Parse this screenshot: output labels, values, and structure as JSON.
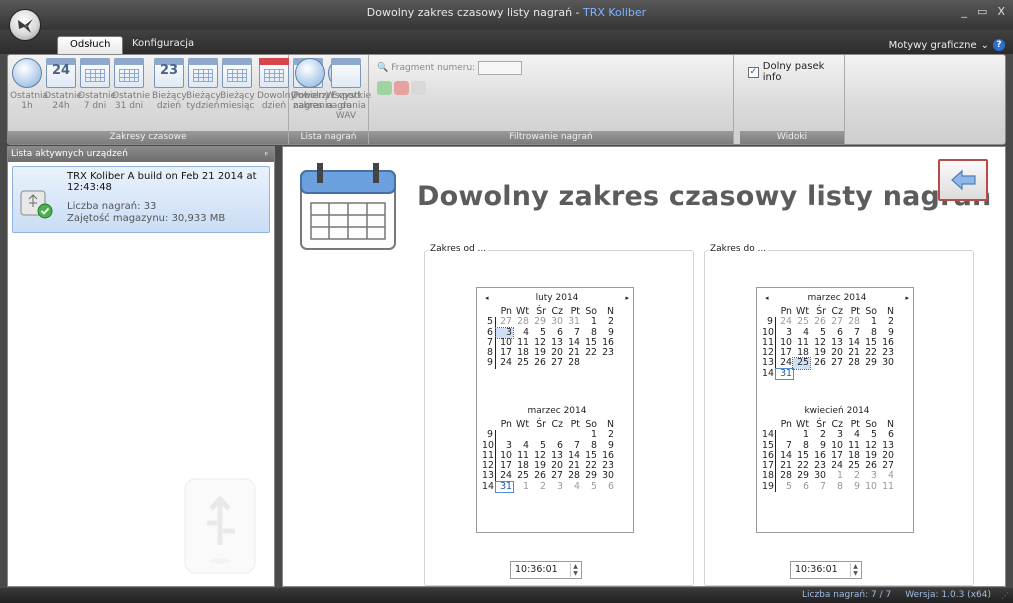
{
  "window": {
    "title_main": "Dowolny zakres czasowy listy nagrań - ",
    "title_app": "TRX Koliber",
    "controls": [
      "_",
      "▭",
      "X"
    ]
  },
  "tabs": [
    {
      "label": "Odsłuch",
      "active": true
    },
    {
      "label": "Konfiguracja",
      "active": false
    }
  ],
  "themes": {
    "label": "Motywy graficzne",
    "chevron": "⌄",
    "help": "?"
  },
  "ribbon": {
    "groups": [
      {
        "label": "Zakresy czasowe",
        "buttons": [
          {
            "icon": "clock-icon",
            "line1": "Ostatnia",
            "line2": "1h"
          },
          {
            "icon": "calendar-24-icon",
            "number": "24",
            "line1": "Ostatnie",
            "line2": "24h"
          },
          {
            "icon": "calendar-week-icon",
            "line1": "Ostatnie",
            "line2": "7 dni"
          },
          {
            "icon": "calendar-month-icon",
            "line1": "Ostatnie",
            "line2": "31 dni"
          },
          {
            "icon": "calendar-day-icon",
            "number": "23",
            "line1": "Bieżący",
            "line2": "dzień"
          },
          {
            "icon": "calendar-week-icon",
            "line1": "Bieżący",
            "line2": "tydzień"
          },
          {
            "icon": "calendar-month-icon",
            "line1": "Bieżący",
            "line2": "miesiąc"
          },
          {
            "icon": "calendar-question-icon",
            "line1": "Dowolny",
            "line2": "dzień"
          },
          {
            "icon": "calendar-range-icon",
            "line1": "Dowolny",
            "line2": "zakres"
          },
          {
            "icon": "globe-icon",
            "line1": "Wszystkie",
            "line2": "nagrania"
          }
        ]
      },
      {
        "label": "Lista nagrań",
        "buttons": [
          {
            "icon": "refresh-icon",
            "line1": "Pobierz",
            "line2": "nagrania"
          },
          {
            "icon": "wav-export-icon",
            "line1": "Export",
            "line2": "do WAV"
          }
        ]
      },
      {
        "label": "Filtrowanie nagrań",
        "fragment_label": "Fragment numeru:"
      },
      {
        "label": "Widoki",
        "checkbox_label": "Dolny pasek info",
        "checked": true
      }
    ]
  },
  "sidebar": {
    "title": "Lista aktywnych urządzeń",
    "pin": "ᵖ",
    "device": {
      "name": "TRX Koliber A build on Feb 21 2014 at 12:43:48",
      "recordings": "Liczba nagrań: 33",
      "storage": "Zajętość magazynu: 30,933 MB"
    }
  },
  "main": {
    "title": "Dowolny zakres czasowy listy nagrań",
    "from": {
      "legend": "Zakres od ...",
      "time": "10:36:01",
      "months": [
        {
          "name": "luty 2014",
          "nav": [
            "◂",
            "▸"
          ],
          "days_header": [
            "Pn",
            "Wt",
            "Śr",
            "Cz",
            "Pt",
            "So",
            "N"
          ],
          "weeks": [
            {
              "wk": "5",
              "days": [
                {
                  "d": "27",
                  "o": 1
                },
                {
                  "d": "28",
                  "o": 1
                },
                {
                  "d": "29",
                  "o": 1
                },
                {
                  "d": "30",
                  "o": 1
                },
                {
                  "d": "31",
                  "o": 1
                },
                {
                  "d": "1"
                },
                {
                  "d": "2"
                }
              ]
            },
            {
              "wk": "6",
              "days": [
                {
                  "d": "3",
                  "s": 1
                },
                {
                  "d": "4"
                },
                {
                  "d": "5"
                },
                {
                  "d": "6"
                },
                {
                  "d": "7"
                },
                {
                  "d": "8"
                },
                {
                  "d": "9"
                }
              ]
            },
            {
              "wk": "7",
              "days": [
                {
                  "d": "10"
                },
                {
                  "d": "11"
                },
                {
                  "d": "12"
                },
                {
                  "d": "13"
                },
                {
                  "d": "14"
                },
                {
                  "d": "15"
                },
                {
                  "d": "16"
                }
              ]
            },
            {
              "wk": "8",
              "days": [
                {
                  "d": "17"
                },
                {
                  "d": "18"
                },
                {
                  "d": "19"
                },
                {
                  "d": "20"
                },
                {
                  "d": "21"
                },
                {
                  "d": "22"
                },
                {
                  "d": "23"
                }
              ]
            },
            {
              "wk": "9",
              "days": [
                {
                  "d": "24"
                },
                {
                  "d": "25"
                },
                {
                  "d": "26"
                },
                {
                  "d": "27"
                },
                {
                  "d": "28"
                },
                {
                  "d": ""
                },
                {
                  "d": ""
                }
              ]
            }
          ]
        },
        {
          "name": "marzec 2014",
          "nav": [
            "",
            ""
          ],
          "days_header": [
            "Pn",
            "Wt",
            "Śr",
            "Cz",
            "Pt",
            "So",
            "N"
          ],
          "weeks": [
            {
              "wk": "9",
              "days": [
                {
                  "d": ""
                },
                {
                  "d": ""
                },
                {
                  "d": ""
                },
                {
                  "d": ""
                },
                {
                  "d": ""
                },
                {
                  "d": "1"
                },
                {
                  "d": "2"
                }
              ]
            },
            {
              "wk": "10",
              "days": [
                {
                  "d": "3"
                },
                {
                  "d": "4"
                },
                {
                  "d": "5"
                },
                {
                  "d": "6"
                },
                {
                  "d": "7"
                },
                {
                  "d": "8"
                },
                {
                  "d": "9"
                }
              ]
            },
            {
              "wk": "11",
              "days": [
                {
                  "d": "10"
                },
                {
                  "d": "11"
                },
                {
                  "d": "12"
                },
                {
                  "d": "13"
                },
                {
                  "d": "14"
                },
                {
                  "d": "15"
                },
                {
                  "d": "16"
                }
              ]
            },
            {
              "wk": "12",
              "days": [
                {
                  "d": "17"
                },
                {
                  "d": "18"
                },
                {
                  "d": "19"
                },
                {
                  "d": "20"
                },
                {
                  "d": "21"
                },
                {
                  "d": "22"
                },
                {
                  "d": "23"
                }
              ]
            },
            {
              "wk": "13",
              "days": [
                {
                  "d": "24"
                },
                {
                  "d": "25"
                },
                {
                  "d": "26"
                },
                {
                  "d": "27"
                },
                {
                  "d": "28"
                },
                {
                  "d": "29"
                },
                {
                  "d": "30"
                }
              ]
            },
            {
              "wk": "14",
              "days": [
                {
                  "d": "31",
                  "t": 1
                },
                {
                  "d": "1",
                  "o": 1
                },
                {
                  "d": "2",
                  "o": 1
                },
                {
                  "d": "3",
                  "o": 1
                },
                {
                  "d": "4",
                  "o": 1
                },
                {
                  "d": "5",
                  "o": 1
                },
                {
                  "d": "6",
                  "o": 1
                }
              ]
            }
          ]
        }
      ]
    },
    "to": {
      "legend": "Zakres do ...",
      "time": "10:36:01",
      "months": [
        {
          "name": "marzec 2014",
          "nav": [
            "◂",
            "▸"
          ],
          "days_header": [
            "Pn",
            "Wt",
            "Śr",
            "Cz",
            "Pt",
            "So",
            "N"
          ],
          "weeks": [
            {
              "wk": "9",
              "days": [
                {
                  "d": "24",
                  "o": 1
                },
                {
                  "d": "25",
                  "o": 1
                },
                {
                  "d": "26",
                  "o": 1
                },
                {
                  "d": "27",
                  "o": 1
                },
                {
                  "d": "28",
                  "o": 1
                },
                {
                  "d": "1"
                },
                {
                  "d": "2"
                }
              ]
            },
            {
              "wk": "10",
              "days": [
                {
                  "d": "3"
                },
                {
                  "d": "4"
                },
                {
                  "d": "5"
                },
                {
                  "d": "6"
                },
                {
                  "d": "7"
                },
                {
                  "d": "8"
                },
                {
                  "d": "9"
                }
              ]
            },
            {
              "wk": "11",
              "days": [
                {
                  "d": "10"
                },
                {
                  "d": "11"
                },
                {
                  "d": "12"
                },
                {
                  "d": "13"
                },
                {
                  "d": "14"
                },
                {
                  "d": "15"
                },
                {
                  "d": "16"
                }
              ]
            },
            {
              "wk": "12",
              "days": [
                {
                  "d": "17"
                },
                {
                  "d": "18"
                },
                {
                  "d": "19"
                },
                {
                  "d": "20"
                },
                {
                  "d": "21"
                },
                {
                  "d": "22"
                },
                {
                  "d": "23"
                }
              ]
            },
            {
              "wk": "13",
              "days": [
                {
                  "d": "24"
                },
                {
                  "d": "25",
                  "s": 1
                },
                {
                  "d": "26"
                },
                {
                  "d": "27"
                },
                {
                  "d": "28"
                },
                {
                  "d": "29"
                },
                {
                  "d": "30"
                }
              ]
            },
            {
              "wk": "14",
              "days": [
                {
                  "d": "31",
                  "t": 1
                },
                {
                  "d": ""
                },
                {
                  "d": ""
                },
                {
                  "d": ""
                },
                {
                  "d": ""
                },
                {
                  "d": ""
                },
                {
                  "d": ""
                }
              ]
            }
          ]
        },
        {
          "name": "kwiecień 2014",
          "nav": [
            "",
            ""
          ],
          "days_header": [
            "Pn",
            "Wt",
            "Śr",
            "Cz",
            "Pt",
            "So",
            "N"
          ],
          "weeks": [
            {
              "wk": "14",
              "days": [
                {
                  "d": ""
                },
                {
                  "d": "1"
                },
                {
                  "d": "2"
                },
                {
                  "d": "3"
                },
                {
                  "d": "4"
                },
                {
                  "d": "5"
                },
                {
                  "d": "6"
                }
              ]
            },
            {
              "wk": "15",
              "days": [
                {
                  "d": "7"
                },
                {
                  "d": "8"
                },
                {
                  "d": "9"
                },
                {
                  "d": "10"
                },
                {
                  "d": "11"
                },
                {
                  "d": "12"
                },
                {
                  "d": "13"
                }
              ]
            },
            {
              "wk": "16",
              "days": [
                {
                  "d": "14"
                },
                {
                  "d": "15"
                },
                {
                  "d": "16"
                },
                {
                  "d": "17"
                },
                {
                  "d": "18"
                },
                {
                  "d": "19"
                },
                {
                  "d": "20"
                }
              ]
            },
            {
              "wk": "17",
              "days": [
                {
                  "d": "21"
                },
                {
                  "d": "22"
                },
                {
                  "d": "23"
                },
                {
                  "d": "24"
                },
                {
                  "d": "25"
                },
                {
                  "d": "26"
                },
                {
                  "d": "27"
                }
              ]
            },
            {
              "wk": "18",
              "days": [
                {
                  "d": "28"
                },
                {
                  "d": "29"
                },
                {
                  "d": "30"
                },
                {
                  "d": "1",
                  "o": 1
                },
                {
                  "d": "2",
                  "o": 1
                },
                {
                  "d": "3",
                  "o": 1
                },
                {
                  "d": "4",
                  "o": 1
                }
              ]
            },
            {
              "wk": "19",
              "days": [
                {
                  "d": "5",
                  "o": 1
                },
                {
                  "d": "6",
                  "o": 1
                },
                {
                  "d": "7",
                  "o": 1
                },
                {
                  "d": "8",
                  "o": 1
                },
                {
                  "d": "9",
                  "o": 1
                },
                {
                  "d": "10",
                  "o": 1
                },
                {
                  "d": "11",
                  "o": 1
                }
              ]
            }
          ]
        }
      ]
    }
  },
  "statusbar": {
    "recordings": "Liczba nagrań: 7 / 7",
    "version": "Wersja: 1.0.3 (x64)",
    "grip": "⋰"
  },
  "colors": {
    "accent": "#4e8ad6",
    "selected": "#cfe0f6",
    "app_name": "#7fb6ff"
  }
}
